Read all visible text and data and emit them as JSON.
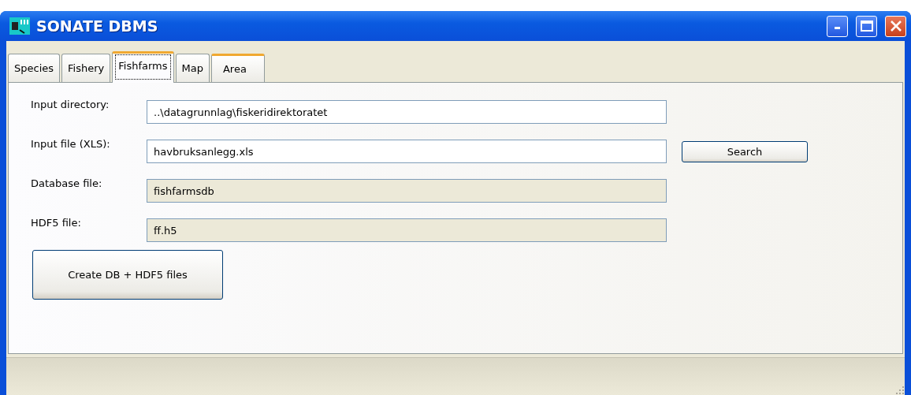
{
  "window": {
    "title": "SONATE DBMS"
  },
  "tabs": [
    {
      "label": "Species",
      "selected": false,
      "highlighted": false
    },
    {
      "label": "Fishery",
      "selected": false,
      "highlighted": false
    },
    {
      "label": "Fishfarms",
      "selected": true,
      "highlighted": false
    },
    {
      "label": "Map",
      "selected": false,
      "highlighted": false
    },
    {
      "label": "Area",
      "selected": false,
      "highlighted": true
    }
  ],
  "fields": [
    {
      "label": "Input directory:",
      "value": "..\\datagrunnlag\\fiskeridirektoratet",
      "readonly": false
    },
    {
      "label": "Input file (XLS):",
      "value": "havbruksanlegg.xls",
      "readonly": false,
      "button": "Search"
    },
    {
      "label": "Database file:",
      "value": "fishfarmsdb",
      "readonly": true
    },
    {
      "label": "HDF5 file:",
      "value": "ff.h5",
      "readonly": true
    }
  ],
  "create_button": "Create DB + HDF5 files"
}
